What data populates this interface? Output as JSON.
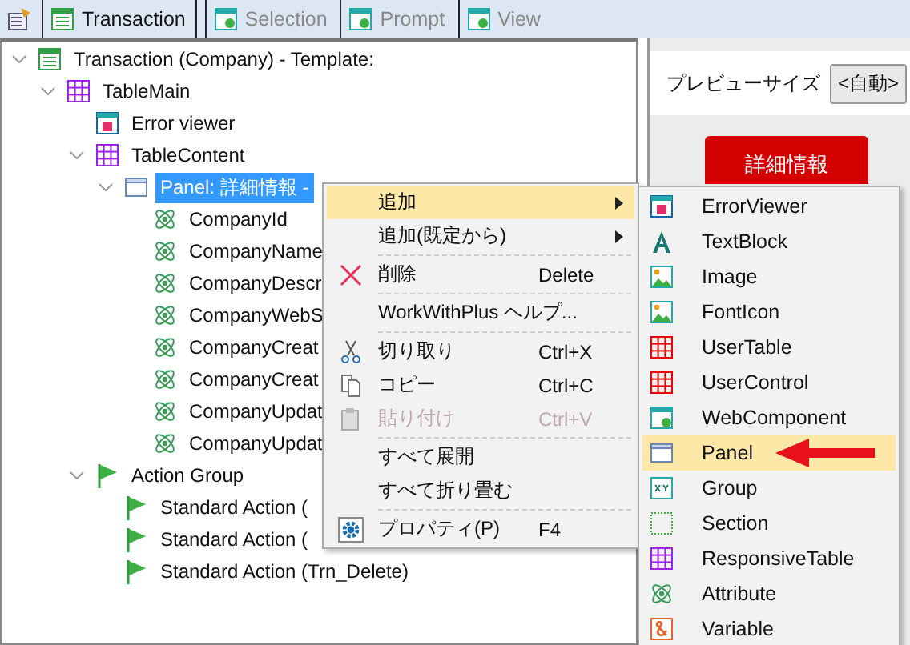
{
  "tabs": [
    {
      "label": "Transaction",
      "selected": true
    },
    {
      "label": "Selection",
      "selected": false
    },
    {
      "label": "Prompt",
      "selected": false
    },
    {
      "label": "View",
      "selected": false
    }
  ],
  "tree": [
    {
      "label": "Transaction (Company) - Template:",
      "kind": "transaction",
      "expanded": true,
      "selected": false,
      "children": [
        {
          "label": "TableMain",
          "kind": "table",
          "expanded": true,
          "selected": false,
          "children": [
            {
              "label": "Error viewer",
              "kind": "errorviewer",
              "selected": false
            },
            {
              "label": "TableContent",
              "kind": "table",
              "expanded": true,
              "selected": false,
              "children": [
                {
                  "label": "Panel: 詳細情報 -",
                  "kind": "panel",
                  "expanded": true,
                  "selected": true,
                  "children": [
                    {
                      "label": "CompanyId",
                      "kind": "attribute",
                      "selected": false
                    },
                    {
                      "label": "CompanyName",
                      "kind": "attribute",
                      "selected": false
                    },
                    {
                      "label": "CompanyDescr",
                      "kind": "attribute",
                      "selected": false
                    },
                    {
                      "label": "CompanyWebS",
                      "kind": "attribute",
                      "selected": false
                    },
                    {
                      "label": "CompanyCreat",
                      "kind": "attribute",
                      "selected": false
                    },
                    {
                      "label": "CompanyCreat",
                      "kind": "attribute",
                      "selected": false
                    },
                    {
                      "label": "CompanyUpdat",
                      "kind": "attribute",
                      "selected": false
                    },
                    {
                      "label": "CompanyUpdat",
                      "kind": "attribute",
                      "selected": false
                    }
                  ]
                }
              ]
            },
            {
              "label": "Action Group",
              "kind": "action",
              "expanded": true,
              "selected": false,
              "children": [
                {
                  "label": "Standard Action (",
                  "kind": "action",
                  "selected": false
                },
                {
                  "label": "Standard Action (",
                  "kind": "action",
                  "selected": false
                },
                {
                  "label": "Standard Action (Trn_Delete)",
                  "kind": "action",
                  "selected": false
                }
              ]
            }
          ]
        }
      ]
    }
  ],
  "preview": {
    "label": "プレビューサイズ",
    "size_value": "<自動>",
    "button": "詳細情報"
  },
  "context_menu": [
    {
      "kind": "item",
      "label": "追加",
      "submenu": true,
      "selected": true,
      "disabled": false
    },
    {
      "kind": "item",
      "label": "追加(既定から)",
      "submenu": true,
      "selected": false,
      "disabled": false
    },
    {
      "kind": "separator"
    },
    {
      "kind": "delete",
      "label": "削除",
      "shortcut": "Delete",
      "submenu": false,
      "selected": false,
      "disabled": false
    },
    {
      "kind": "separator"
    },
    {
      "kind": "item",
      "label": "WorkWithPlus ヘルプ...",
      "submenu": false,
      "selected": false,
      "disabled": false
    },
    {
      "kind": "separator"
    },
    {
      "kind": "cut",
      "label": "切り取り",
      "shortcut": "Ctrl+X",
      "submenu": false,
      "selected": false,
      "disabled": false
    },
    {
      "kind": "copy",
      "label": "コピー",
      "shortcut": "Ctrl+C",
      "submenu": false,
      "selected": false,
      "disabled": false
    },
    {
      "kind": "paste",
      "label": "貼り付け",
      "shortcut": "Ctrl+V",
      "submenu": false,
      "selected": false,
      "disabled": true
    },
    {
      "kind": "separator"
    },
    {
      "kind": "item",
      "label": "すべて展開",
      "submenu": false,
      "selected": false,
      "disabled": false
    },
    {
      "kind": "item",
      "label": "すべて折り畳む",
      "submenu": false,
      "selected": false,
      "disabled": false
    },
    {
      "kind": "separator"
    },
    {
      "kind": "properties",
      "label": "プロパティ(P)",
      "shortcut": "F4",
      "submenu": false,
      "selected": false,
      "disabled": false
    }
  ],
  "submenu": [
    {
      "label": "ErrorViewer",
      "kind": "errorviewer",
      "selected": false,
      "arrow": false
    },
    {
      "label": "TextBlock",
      "kind": "textblock",
      "selected": false,
      "arrow": false
    },
    {
      "label": "Image",
      "kind": "image",
      "selected": false,
      "arrow": false
    },
    {
      "label": "FontIcon",
      "kind": "image",
      "selected": false,
      "arrow": false
    },
    {
      "label": "UserTable",
      "kind": "usertable",
      "selected": false,
      "arrow": false
    },
    {
      "label": "UserControl",
      "kind": "usertable",
      "selected": false,
      "arrow": false
    },
    {
      "label": "WebComponent",
      "kind": "webcomponent",
      "selected": false,
      "arrow": false
    },
    {
      "label": "Panel",
      "kind": "panel",
      "selected": true,
      "arrow": true
    },
    {
      "label": "Group",
      "kind": "group",
      "selected": false,
      "arrow": false
    },
    {
      "label": "Section",
      "kind": "section",
      "selected": false,
      "arrow": false
    },
    {
      "label": "ResponsiveTable",
      "kind": "table",
      "selected": false,
      "arrow": false
    },
    {
      "label": "Attribute",
      "kind": "attribute",
      "selected": false,
      "arrow": false
    },
    {
      "label": "Variable",
      "kind": "variable",
      "selected": false,
      "arrow": false
    }
  ]
}
